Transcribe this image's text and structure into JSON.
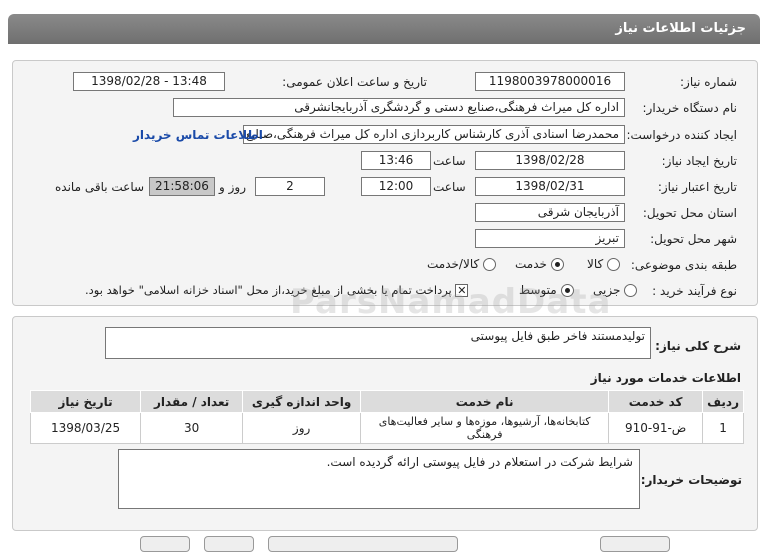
{
  "title": "جزئیات اطلاعات نیاز",
  "form": {
    "need_number_label": "شماره نیاز:",
    "need_number": "1198003978000016",
    "announce_label": "تاریخ و ساعت اعلان عمومی:",
    "announce_value": "1398/02/28 - 13:48",
    "buyer_label": "نام دستگاه خریدار:",
    "buyer_value": "اداره کل میراث فرهنگی،صنایع دستی و گردشگری آذربایجانشرقی",
    "creator_label": "ایجاد کننده درخواست:",
    "creator_value": "محمدرضا اسنادی آذری کارشناس کاربردازی اداره کل میراث فرهنگی،صنایع دست",
    "contact_link": "اطلاعات تماس خریدار",
    "create_date_label": "تاریخ ایجاد نیاز:",
    "create_date": "1398/02/28",
    "time_label": "ساعت",
    "create_time": "13:46",
    "validity_label": "تاریخ اعتبار نیاز:",
    "validity_date": "1398/02/31",
    "validity_time": "12:00",
    "days_value": "2",
    "days_label": "روز و",
    "remaining_time": "21:58:06",
    "remaining_label": "ساعت باقی مانده",
    "province_label": "استان محل تحویل:",
    "province_value": "آذربایجان شرقی",
    "city_label": "شهر محل تحویل:",
    "city_value": "تبریز",
    "category_label": "طبقه بندی موضوعی:",
    "category_options": [
      "کالا",
      "خدمت",
      "کالا/خدمت"
    ],
    "category_selected": "خدمت",
    "process_label": "نوع فرآیند خرید :",
    "process_options": [
      "جزیی",
      "متوسط"
    ],
    "process_selected": "متوسط",
    "payment_note": "پرداخت تمام یا بخشی از مبلغ خرید،از محل \"اسناد خزانه اسلامی\" خواهد بود."
  },
  "summary": {
    "label": "شرح کلی نیاز:",
    "value": "تولیدمستند فاخر طبق فایل پیوستی"
  },
  "services": {
    "section_title": "اطلاعات خدمات مورد نیاز",
    "headers": [
      "ردیف",
      "کد خدمت",
      "نام خدمت",
      "واحد اندازه گیری",
      "تعداد / مقدار",
      "تاریخ نیاز"
    ],
    "rows": [
      [
        "1",
        "ض-91-910",
        "کتابخانه‌ها، آرشیوها، موزه‌ها و سایر فعالیت‌های فرهنگی",
        "روز",
        "30",
        "1398/03/25"
      ]
    ]
  },
  "buyer_notes": {
    "label": "توضیحات خریدار:",
    "value": "شرایط شرکت در استعلام در فایل پیوستی ارائه گردیده است."
  },
  "watermark": "ParsNamadData"
}
